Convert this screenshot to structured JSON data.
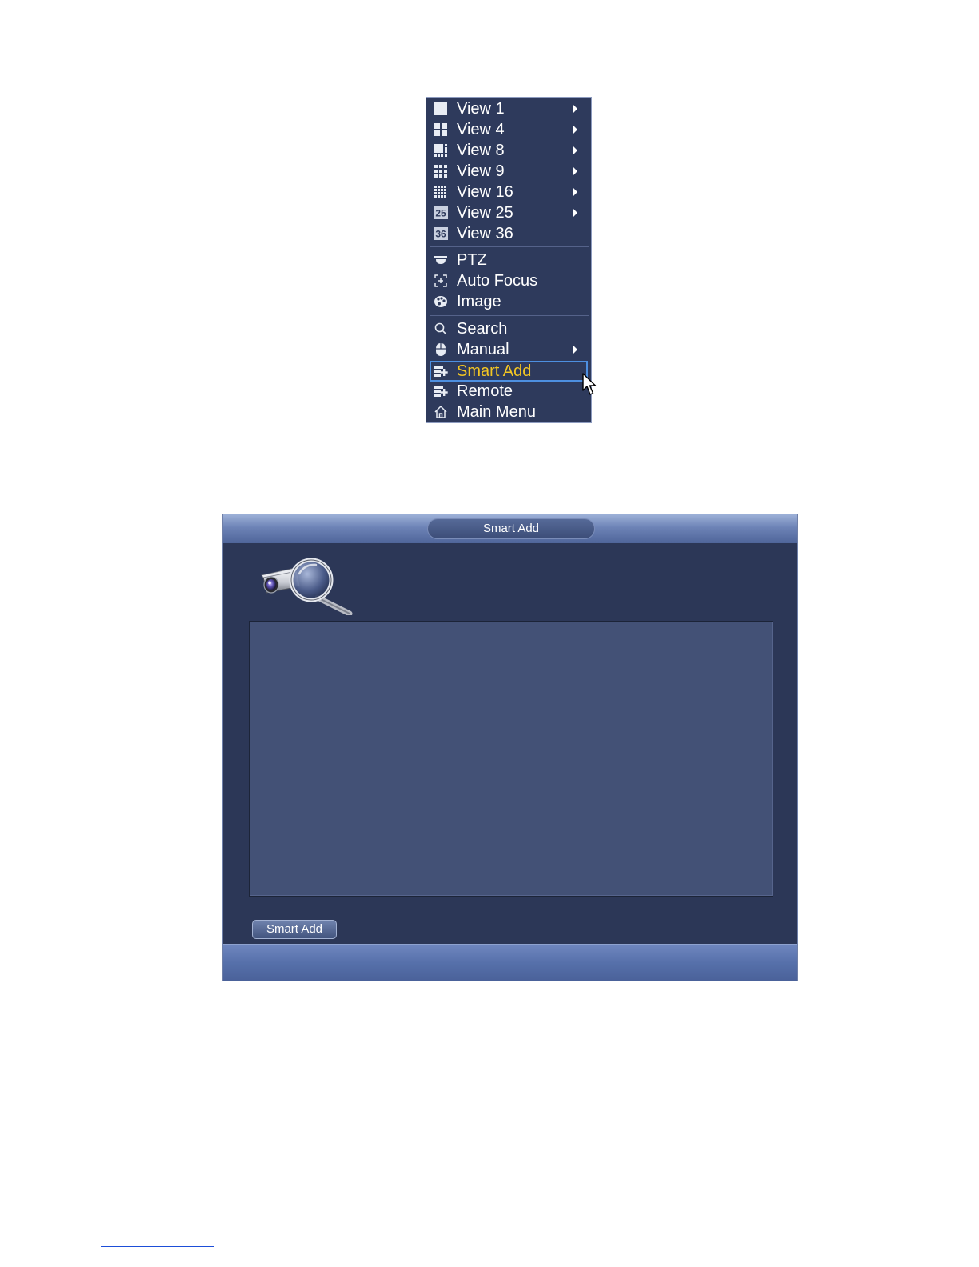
{
  "menu": {
    "items": [
      {
        "label": "View 1",
        "icon": "single-screen-icon",
        "submenu": true
      },
      {
        "label": "View 4",
        "icon": "quad-grid-icon",
        "submenu": true
      },
      {
        "label": "View 8",
        "icon": "eight-split-icon",
        "submenu": true
      },
      {
        "label": "View 9",
        "icon": "nine-grid-icon",
        "submenu": true
      },
      {
        "label": "View 16",
        "icon": "sixteen-grid-icon",
        "submenu": true
      },
      {
        "label": "View 25",
        "icon": "twenty-five-icon",
        "icon_text": "25",
        "submenu": true
      },
      {
        "label": "View 36",
        "icon": "thirty-six-icon",
        "icon_text": "36",
        "submenu": false
      },
      {
        "label": "PTZ",
        "icon": "ptz-dome-icon",
        "submenu": false
      },
      {
        "label": "Auto Focus",
        "icon": "focus-frame-icon",
        "submenu": false
      },
      {
        "label": "Image",
        "icon": "palette-icon",
        "submenu": false
      },
      {
        "label": "Search",
        "icon": "search-icon",
        "submenu": false
      },
      {
        "label": "Manual",
        "icon": "mouse-icon",
        "submenu": true
      },
      {
        "label": "Smart Add",
        "icon": "add-device-icon",
        "submenu": false,
        "selected": true
      },
      {
        "label": "Remote",
        "icon": "remote-device-icon",
        "submenu": false
      },
      {
        "label": "Main Menu",
        "icon": "home-icon",
        "submenu": false
      }
    ]
  },
  "dialog": {
    "title": "Smart Add",
    "button_label": "Smart Add",
    "illustration_icon": "camera-magnifier-icon"
  },
  "colors": {
    "menu_bg": "#2e3a5c",
    "selected_text": "#f3c623",
    "selected_border": "#4d8fe0",
    "dialog_bg": "#2c3757",
    "list_bg": "#435176"
  }
}
